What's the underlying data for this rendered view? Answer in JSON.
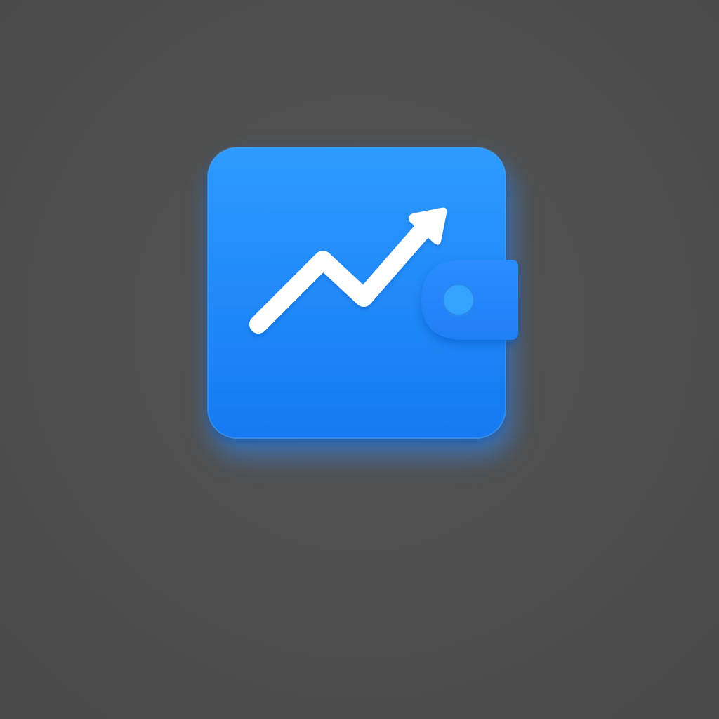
{
  "canvas": {
    "background_color": "#545454",
    "vignette_color": "#4a4a4a"
  },
  "icon": {
    "name": "wallet-growth-icon",
    "body_color_top": "#2e9bff",
    "body_color_bottom": "#1479f2",
    "clasp_color": "#2a8cff",
    "button_color": "#34a3ff",
    "arrow_color": "#ffffff",
    "glow_color": "#2f8cff",
    "trend": "up"
  }
}
